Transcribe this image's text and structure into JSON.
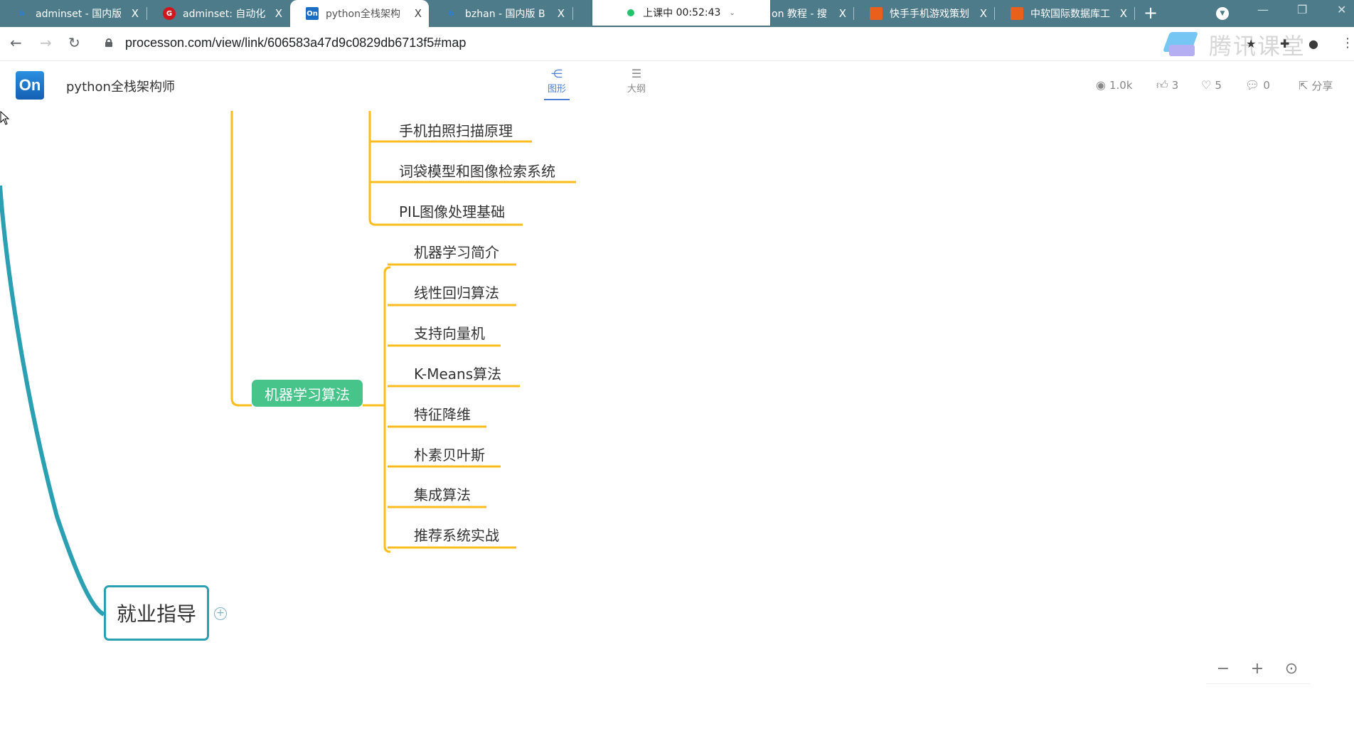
{
  "browser": {
    "tabs": [
      {
        "title": "adminset - 国内版",
        "favicon": "bing-icon",
        "active": false
      },
      {
        "title": "adminset: 自动化",
        "favicon": "g-icon",
        "active": false
      },
      {
        "title": "python全栈架构",
        "favicon": "processon-icon",
        "active": true
      },
      {
        "title": "bzhan - 国内版 B",
        "favicon": "bing-icon",
        "active": false
      },
      {
        "title": "on 教程 - 搜",
        "favicon": "generic-icon",
        "active": false
      },
      {
        "title": "快手手机游戏策划",
        "favicon": "orange-icon",
        "active": false
      },
      {
        "title": "中软国际数据库工",
        "favicon": "orange-icon",
        "active": false
      }
    ],
    "close_glyph": "X",
    "new_tab_glyph": "+",
    "class_timer": {
      "status": "上课中",
      "time": "00:52:43"
    },
    "url": "processon.com/view/link/606583a47d9c0829db6713f5#map",
    "watermark": "腾讯课堂"
  },
  "app": {
    "logo": "On",
    "title": "python全栈架构师",
    "view_tabs": [
      {
        "label": "图形",
        "icon": "mindmap-icon",
        "active": true
      },
      {
        "label": "大纲",
        "icon": "outline-icon",
        "active": false
      }
    ],
    "stats": {
      "views": "1.0k",
      "likes": "3",
      "favorites": "5",
      "comments": "0",
      "share_label": "分享"
    }
  },
  "mindmap": {
    "colors": {
      "branch": "#fbbd1d",
      "main_line": "#2ba0b2",
      "green_node": "#47c48a"
    },
    "upper_leaves": [
      "手机拍照扫描原理",
      "词袋模型和图像检索系统",
      "PIL图像处理基础"
    ],
    "ml_node": "机器学习算法",
    "ml_children": [
      "机器学习简介",
      "线性回归算法",
      "支持向量机",
      "K-Means算法",
      "特征降维",
      "朴素贝叶斯",
      "集成算法",
      "推荐系统实战"
    ],
    "main_node": "就业指导",
    "expand_glyph": "+"
  },
  "zoom_controls": {
    "zoom_out": "−",
    "zoom_in": "+",
    "locate": "⊙"
  }
}
